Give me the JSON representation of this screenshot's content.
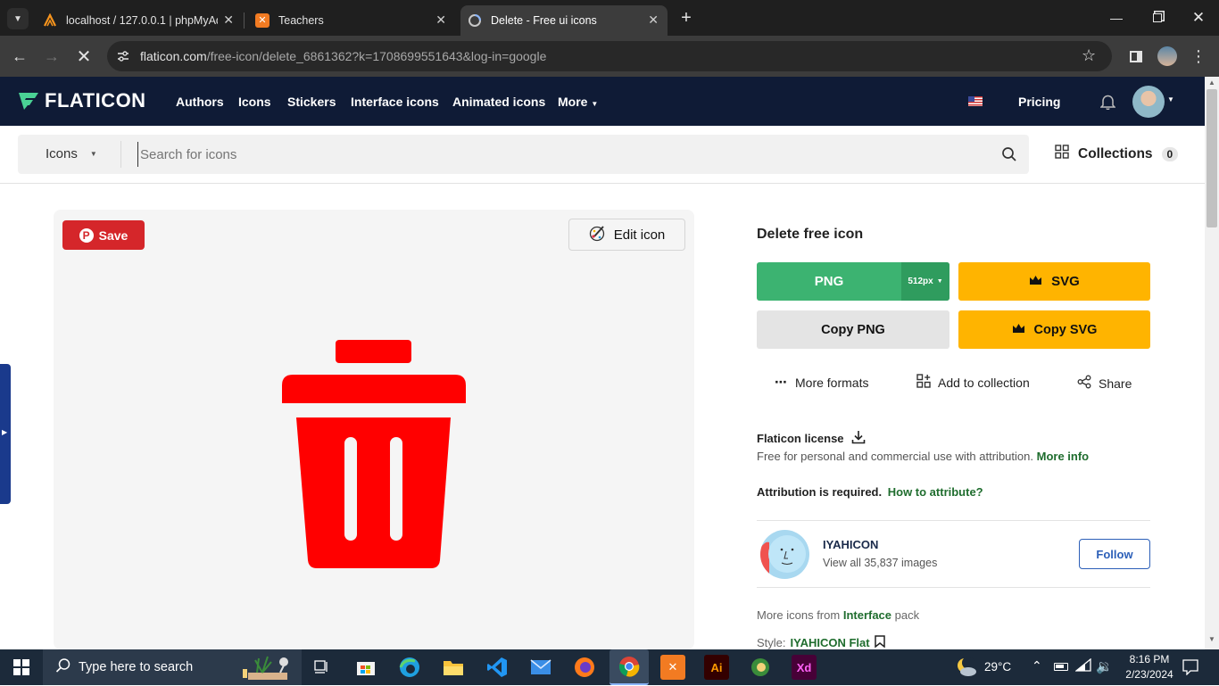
{
  "browser": {
    "tabs": [
      {
        "label": "localhost / 127.0.0.1 | phpMyAd"
      },
      {
        "label": "Teachers"
      },
      {
        "label": "Delete - Free ui icons"
      }
    ],
    "url_main": "flaticon.com",
    "url_rest": "/free-icon/delete_6861362?k=1708699551643&log-in=google"
  },
  "header": {
    "logo": "FLATICON",
    "nav": [
      "Authors",
      "Icons",
      "Stickers",
      "Interface icons",
      "Animated icons",
      "More"
    ],
    "pricing": "Pricing"
  },
  "search": {
    "category": "Icons",
    "placeholder": "Search for icons",
    "collections_label": "Collections",
    "collections_count": "0"
  },
  "preview": {
    "save_label": "Save",
    "edit_label": "Edit icon",
    "icon_color": "#ff0000"
  },
  "details": {
    "title": "Delete free icon",
    "png_label": "PNG",
    "png_size": "512px",
    "svg_label": "SVG",
    "copy_png_label": "Copy PNG",
    "copy_svg_label": "Copy SVG",
    "more_formats": "More formats",
    "add_to_collection": "Add to collection",
    "share": "Share",
    "license_title": "Flaticon license",
    "license_text": "Free for personal and commercial use with attribution.",
    "more_info": "More info",
    "attribution_required": "Attribution is required.",
    "how_to_attribute": "How to attribute?",
    "author_name": "IYAHICON",
    "author_images": "View all 35,837 images",
    "follow": "Follow",
    "more_icons_prefix": "More icons from",
    "pack_name": "Interface",
    "more_icons_suffix": "pack",
    "style_label": "Style:",
    "style_name": "IYAHICON Flat"
  },
  "colors": {
    "header_bg": "#0f1b36",
    "png_green": "#3cb371",
    "svg_yellow": "#ffb400",
    "save_red": "#d5262a",
    "link_green": "#1f6d2e"
  },
  "taskbar": {
    "search_placeholder": "Type here to search",
    "temperature": "29°C",
    "time": "8:16 PM",
    "date": "2/23/2024"
  }
}
